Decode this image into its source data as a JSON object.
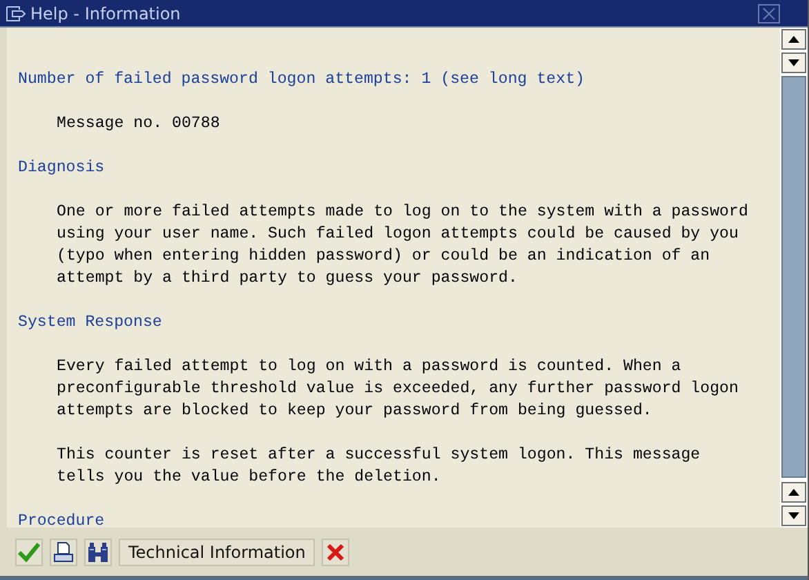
{
  "window": {
    "title": "Help - Information"
  },
  "blocks": [
    {
      "kind": "heading",
      "lines": [
        "Number of failed password logon attempts: 1 (see long text)"
      ]
    },
    {
      "kind": "text",
      "lines": [
        "Message no. 00788"
      ]
    },
    {
      "kind": "heading",
      "lines": [
        "Diagnosis"
      ]
    },
    {
      "kind": "text",
      "lines": [
        "One or more failed attempts made to log on to the system with a password",
        "using your user name. Such failed logon attempts could be caused by you",
        "(typo when entering hidden password) or could be an indication of an",
        "attempt by a third party to guess your password."
      ]
    },
    {
      "kind": "heading",
      "lines": [
        "System Response"
      ]
    },
    {
      "kind": "text",
      "lines": [
        "Every failed attempt to log on with a password is counted. When a",
        "preconfigurable threshold value is exceeded, any further password logon",
        "attempts are blocked to keep your password from being guessed."
      ]
    },
    {
      "kind": "text",
      "lines": [
        "This counter is reset after a successful system logon. This message",
        "tells you the value before the deletion."
      ]
    },
    {
      "kind": "heading",
      "lines": [
        "Procedure"
      ]
    }
  ],
  "toolbar": {
    "technical_button": "Technical Information"
  }
}
